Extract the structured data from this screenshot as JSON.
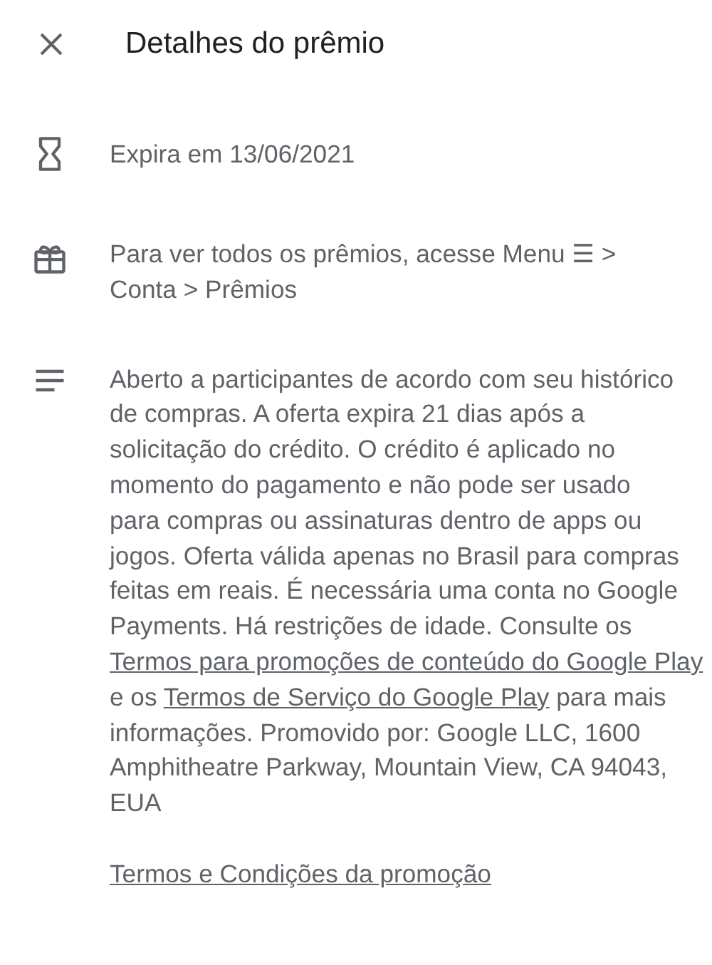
{
  "header": {
    "title": "Detalhes do prêmio"
  },
  "rows": [
    {
      "kind": "expiry",
      "text": "Expira em 13/06/2021"
    },
    {
      "kind": "gift",
      "text": "Para ver todos os prêmios, acesse Menu ☰ > Conta > Prêmios"
    }
  ],
  "description": {
    "segments": [
      {
        "kind": "text",
        "text": "Aberto a participantes de acordo com seu histórico de compras. A oferta expira 21 dias após a solicitação do crédito. O crédito é aplicado no momento do pagamento e não pode ser usado para compras ou assinaturas dentro de apps ou jogos. Oferta válida apenas no Brasil para compras feitas em reais. É necessária uma conta no Google Payments. Há restrições de idade. Consulte os "
      },
      {
        "kind": "link",
        "text": "Termos para promoções de conteúdo do Google Play"
      },
      {
        "kind": "text",
        "text": " e os "
      },
      {
        "kind": "link",
        "text": "Termos de Serviço do Google Play"
      },
      {
        "kind": "text",
        "text": " para mais informações. Promovido por: Google LLC, 1600 Amphitheatre Parkway, Mountain View, CA 94043, EUA"
      }
    ]
  },
  "footer_link": "Termos e Condições da promoção"
}
